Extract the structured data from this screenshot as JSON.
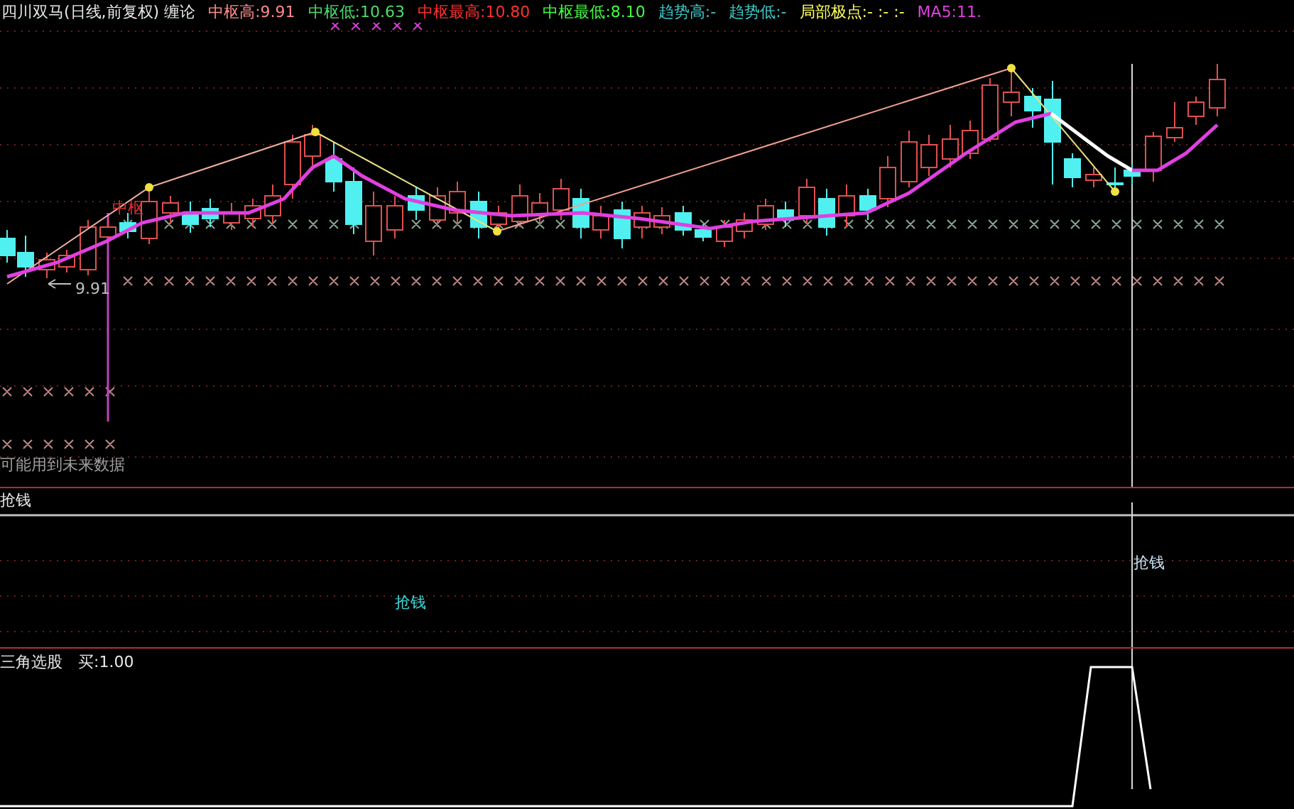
{
  "header": [
    {
      "text": "四川双马(日线,前复权) 缠论",
      "color": "#e8e8e8"
    },
    {
      "text": "中枢高:9.91",
      "color": "#ff8c8c"
    },
    {
      "text": "中枢低:10.63",
      "color": "#4cdc6c"
    },
    {
      "text": "中枢最高:10.80",
      "color": "#ff3030"
    },
    {
      "text": "中枢最低:8.10",
      "color": "#40ff40"
    },
    {
      "text": "趋势高:-",
      "color": "#40c8c8"
    },
    {
      "text": "趋势低:-",
      "color": "#40c8c8"
    },
    {
      "text": "局部极点:- :- :-",
      "color": "#ffff60"
    },
    {
      "text": "MA5:11.",
      "color": "#e040e0"
    }
  ],
  "main_chart": {
    "zone_label": "中枢",
    "price_label": "9.91",
    "warning": "可能用到未来数据"
  },
  "signal_panel": {
    "title": "抢钱",
    "signals": [
      {
        "text": "抢钱",
        "color": "#40d8d8"
      },
      {
        "text": "抢钱",
        "color": "#c8e0f0"
      }
    ]
  },
  "triangle_panel": {
    "title": "三角选股",
    "value": "买:1.00"
  }
}
